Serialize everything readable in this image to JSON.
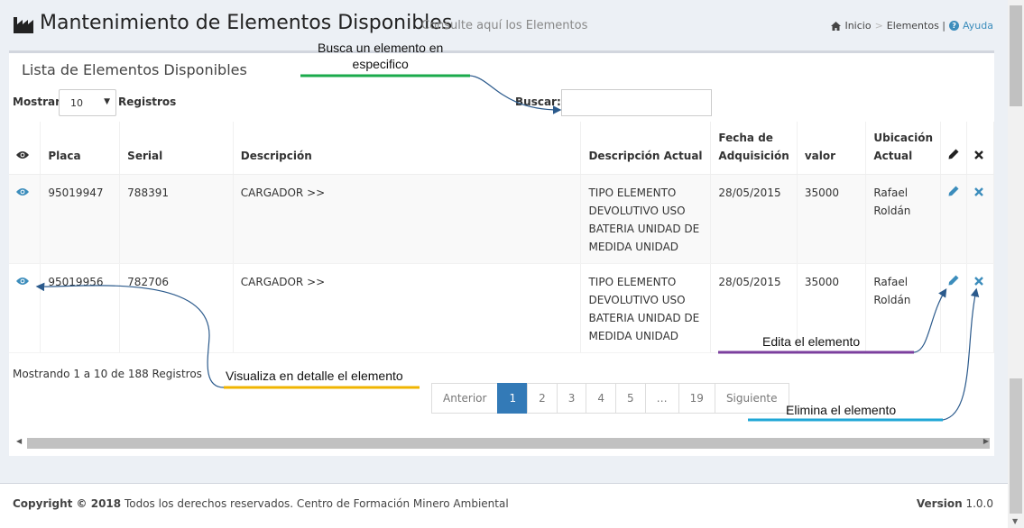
{
  "header": {
    "title": "Mantenimiento de Elementos Disponibles",
    "subtitle": "Consulte aquí los Elementos",
    "breadcrumb": {
      "home": "Inicio",
      "current": "Elementos |",
      "help": "Ayuda"
    }
  },
  "box": {
    "title": "Lista de Elementos Disponibles",
    "length_prefix": "Mostrar",
    "length_value": "10",
    "length_suffix": "Registros",
    "search_label": "Buscar:",
    "search_value": ""
  },
  "table": {
    "columns": [
      "Placa",
      "Serial",
      "Descripción",
      "Descripción Actual",
      "Fecha de Adquisición",
      "valor",
      "Ubicación Actual"
    ],
    "rows": [
      {
        "placa": "95019947",
        "serial": "788391",
        "descripcion": "CARGADOR >>",
        "descripcion_actual": "TIPO ELEMENTO DEVOLUTIVO USO BATERIA UNIDAD DE MEDIDA UNIDAD",
        "fecha": "28/05/2015",
        "valor": "35000",
        "ubicacion": "Rafael Roldán"
      },
      {
        "placa": "95019956",
        "serial": "782706",
        "descripcion": "CARGADOR >>",
        "descripcion_actual": "TIPO ELEMENTO DEVOLUTIVO USO BATERIA UNIDAD DE MEDIDA UNIDAD",
        "fecha": "28/05/2015",
        "valor": "35000",
        "ubicacion": "Rafael Roldán"
      }
    ]
  },
  "info": "Mostrando 1 a 10 de 188 Registros",
  "pagination": {
    "prev": "Anterior",
    "pages": [
      "1",
      "2",
      "3",
      "4",
      "5",
      "…",
      "19"
    ],
    "next": "Siguiente",
    "active": "1"
  },
  "footer": {
    "copyright_bold": "Copyright © 2018",
    "copyright_text": "Todos los derechos reservados. Centro de Formación Minero Ambiental",
    "version_label": "Version",
    "version_value": "1.0.0"
  },
  "annotations": {
    "search": "Busca un elemento en\nespecifico",
    "view": "Visualiza en detalle el elemento",
    "edit": "Edita el elemento",
    "delete": "Elimina el elemento"
  },
  "colors": {
    "primary": "#3c8dbc",
    "active_page": "#337ab7",
    "green": "#1aaa4b",
    "yellow": "#f0b400",
    "purple": "#7b3f9e",
    "cyan": "#1fa7d6"
  },
  "icons": [
    "factory-icon",
    "home-icon",
    "help-icon",
    "eye-icon",
    "pencil-icon",
    "times-icon"
  ]
}
